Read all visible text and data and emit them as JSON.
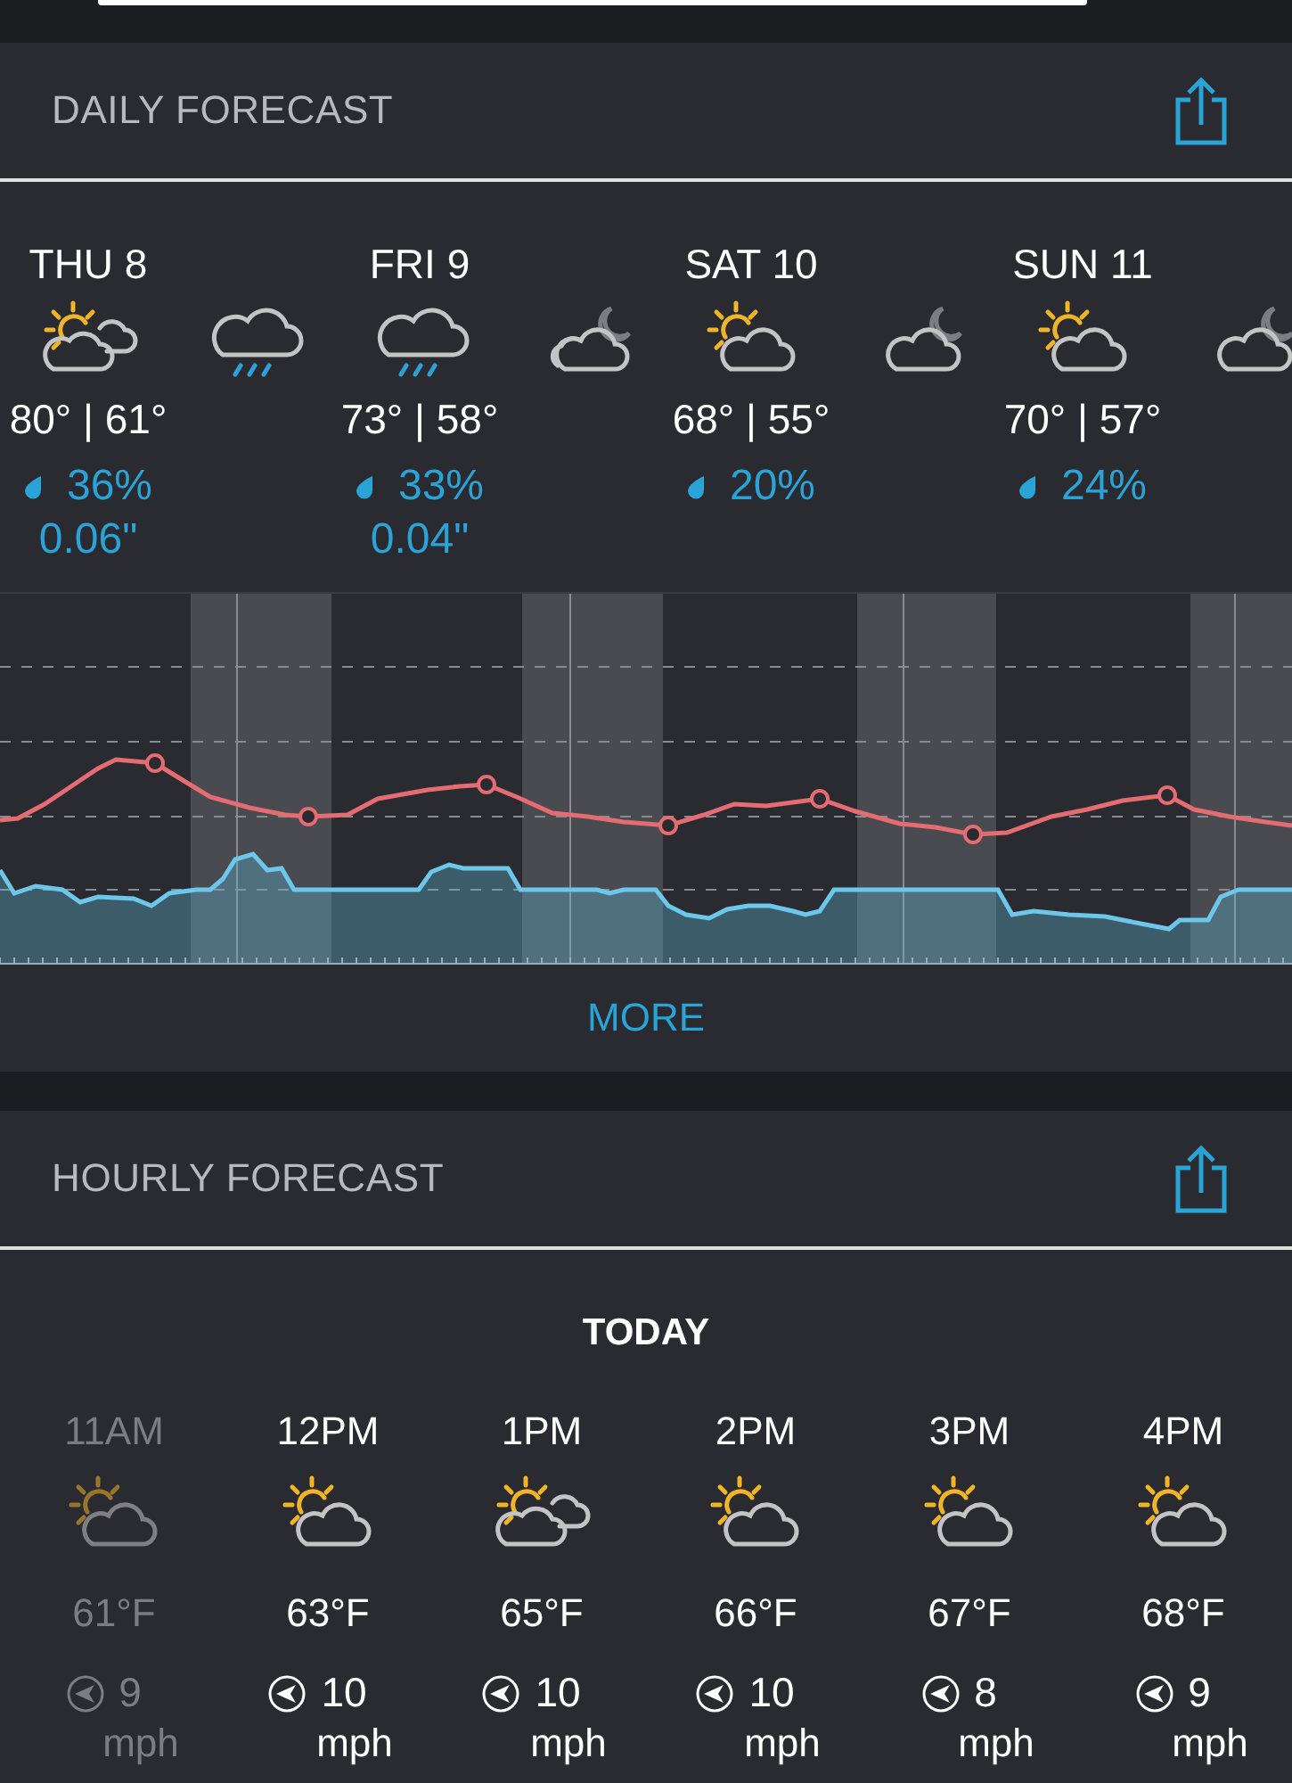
{
  "daily": {
    "title": "DAILY FORECAST",
    "days": [
      {
        "label": "THU 8",
        "temps": "80° | 61°",
        "precip_chance": "36%",
        "precip_amount": "0.06\""
      },
      {
        "label": "FRI 9",
        "temps": "73° | 58°",
        "precip_chance": "33%",
        "precip_amount": "0.04\""
      },
      {
        "label": "SAT 10",
        "temps": "68° | 55°",
        "precip_chance": "20%"
      },
      {
        "label": "SUN 11",
        "temps": "70° | 57°",
        "precip_chance": "24%"
      }
    ],
    "icons": [
      {
        "kind": "sun-clouds"
      },
      {
        "kind": "rain"
      },
      {
        "kind": "rain"
      },
      {
        "kind": "moon-clouds"
      },
      {
        "kind": "sun-cloud"
      },
      {
        "kind": "moon-cloud"
      },
      {
        "kind": "sun-cloud"
      },
      {
        "kind": "moon-cloud"
      }
    ],
    "more": "MORE"
  },
  "hourly": {
    "title": "HOURLY FORECAST",
    "day": "TODAY",
    "hours": [
      {
        "time": "11AM",
        "kind": "sun-cloud",
        "temp": "61°F",
        "wind": "9",
        "unit": "mph",
        "past": true
      },
      {
        "time": "12PM",
        "kind": "sun-cloud",
        "temp": "63°F",
        "wind": "10",
        "unit": "mph",
        "past": false
      },
      {
        "time": "1PM",
        "kind": "sun-clouds",
        "temp": "65°F",
        "wind": "10",
        "unit": "mph",
        "past": false
      },
      {
        "time": "2PM",
        "kind": "sun-cloud",
        "temp": "66°F",
        "wind": "10",
        "unit": "mph",
        "past": false
      },
      {
        "time": "3PM",
        "kind": "sun-cloud",
        "temp": "67°F",
        "wind": "8",
        "unit": "mph",
        "past": false
      },
      {
        "time": "4PM",
        "kind": "sun-cloud",
        "temp": "68°F",
        "wind": "9",
        "unit": "mph",
        "past": false
      }
    ]
  }
}
